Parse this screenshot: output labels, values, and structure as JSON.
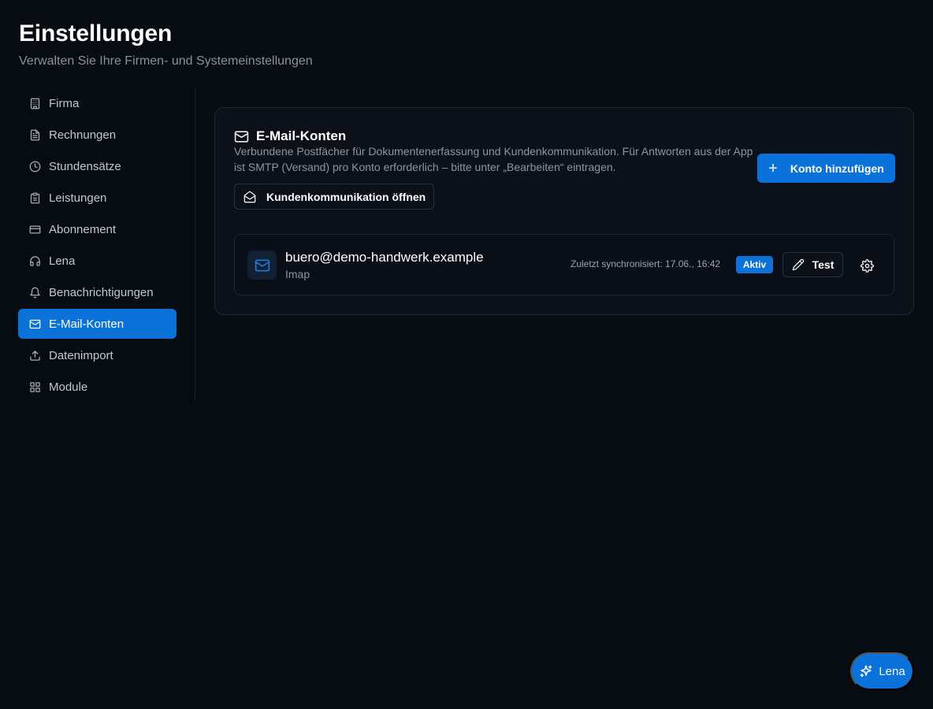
{
  "header": {
    "title": "Einstellungen",
    "subtitle": "Verwalten Sie Ihre Firmen- und Systemeinstellungen"
  },
  "sidebar": {
    "items": [
      {
        "label": "Firma",
        "icon": "building-icon"
      },
      {
        "label": "Rechnungen",
        "icon": "file-text-icon"
      },
      {
        "label": "Stundensätze",
        "icon": "clock-icon"
      },
      {
        "label": "Leistungen",
        "icon": "clipboard-icon"
      },
      {
        "label": "Abonnement",
        "icon": "credit-card-icon"
      },
      {
        "label": "Lena",
        "icon": "headphones-icon"
      },
      {
        "label": "Benachrichtigungen",
        "icon": "bell-icon"
      },
      {
        "label": "E-Mail-Konten",
        "icon": "mail-icon",
        "active": true
      },
      {
        "label": "Datenimport",
        "icon": "upload-icon"
      },
      {
        "label": "Module",
        "icon": "grid-icon"
      }
    ]
  },
  "email_accounts": {
    "title": "E-Mail-Konten",
    "description": "Verbundene Postfächer für Dokumentenerfassung und Kundenkommunikation. Für Antworten aus der App ist SMTP (Versand) pro Konto erforderlich – bitte unter „Bearbeiten“ eintragen.",
    "add_button_label": "Konto hinzufügen",
    "open_comm_button_label": "Kundenkommunikation öffnen",
    "accounts": [
      {
        "email": "buero@demo-handwerk.example",
        "type": "Imap",
        "last_sync": "Zuletzt synchronisiert: 17.06., 16:42",
        "status": "Aktiv",
        "test_label": "Test"
      }
    ]
  },
  "assistant_fab": {
    "label": "Lena",
    "icon": "sparkles-icon"
  },
  "colors": {
    "background": "#070b12",
    "card": "#0c1119",
    "accent": "#0a72d8",
    "muted_text": "#8e949e"
  }
}
